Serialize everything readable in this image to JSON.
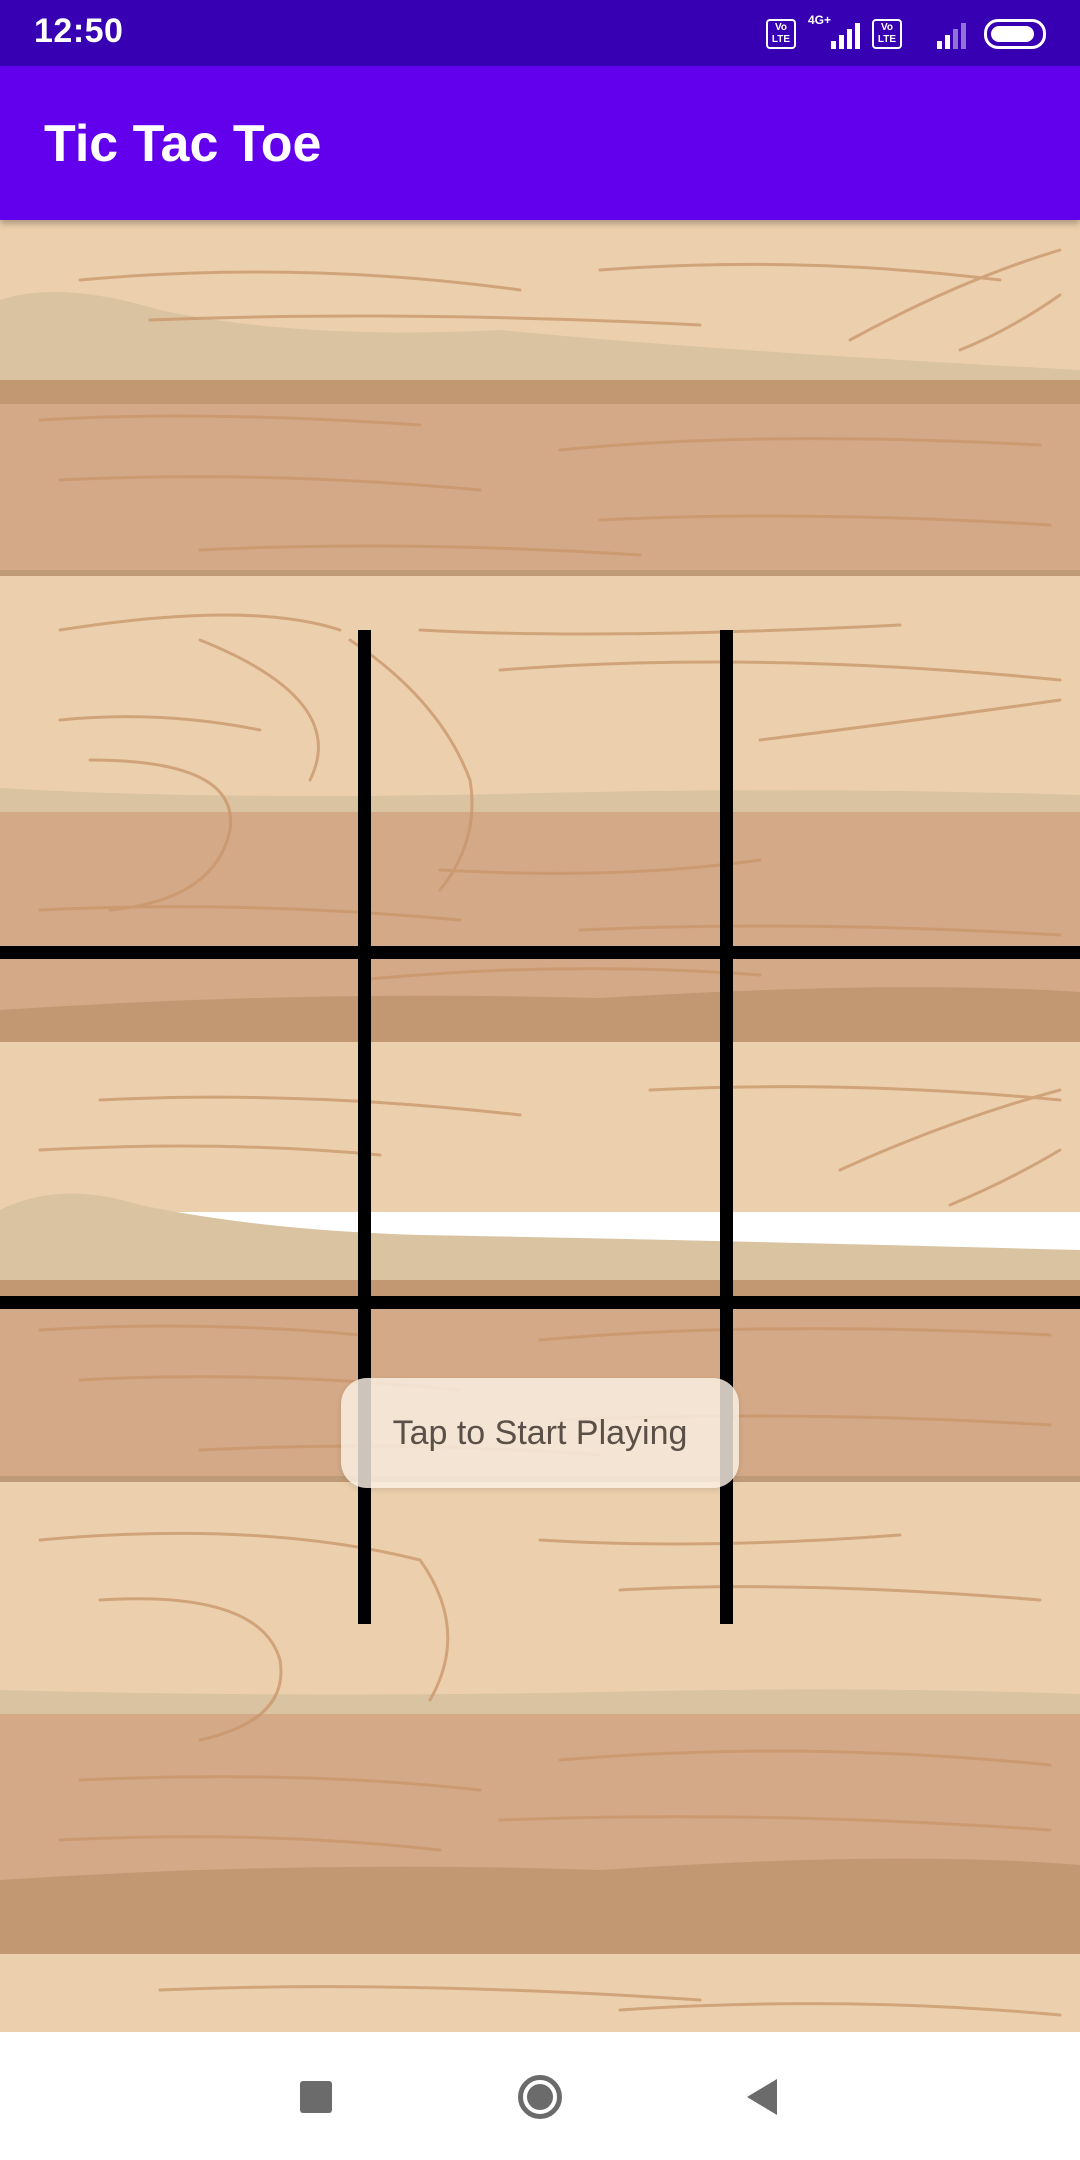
{
  "status_bar": {
    "time": "12:50",
    "sim1_label_top": "Vo",
    "sim1_label_bottom": "LTE",
    "network_type": "4G+",
    "sim2_label_top": "Vo",
    "sim2_label_bottom": "LTE",
    "icons": [
      "volte-icon",
      "signal-4g-icon",
      "volte-icon",
      "signal-icon",
      "battery-icon"
    ],
    "battery_level": 0.9
  },
  "app_bar": {
    "title": "Tic Tac Toe"
  },
  "board": {
    "rows": 3,
    "cols": 3,
    "cells": [
      "",
      "",
      "",
      "",
      "",
      "",
      "",
      "",
      ""
    ],
    "line_color": "#000000"
  },
  "toast": {
    "message": "Tap to Start Playing"
  },
  "nav_bar": {
    "buttons": [
      "recents-icon",
      "home-icon",
      "back-icon"
    ]
  },
  "colors": {
    "status_bar": "#3700b3",
    "app_bar": "#6200ee",
    "wood_light": "#ecd0ad",
    "wood_dark": "#d4a987",
    "grain": "#c9956a"
  }
}
